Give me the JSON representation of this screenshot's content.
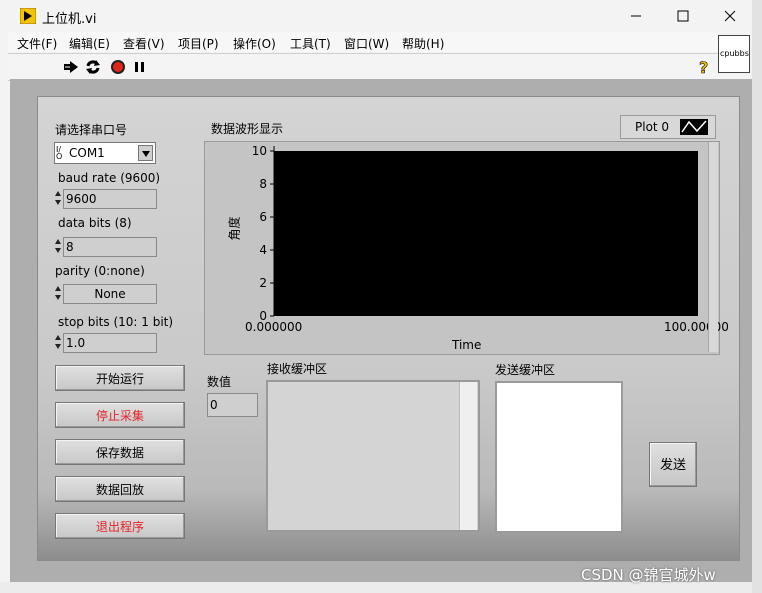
{
  "window": {
    "title": "上位机.vi",
    "right_box_label": "cpubbs"
  },
  "menu": [
    "文件(F)",
    "编辑(E)",
    "查看(V)",
    "项目(P)",
    "操作(O)",
    "工具(T)",
    "窗口(W)",
    "帮助(H)"
  ],
  "serial": {
    "port_label": "请选择串口号",
    "port_prefix": "I/O",
    "port_value": "COM1",
    "baud_label": "baud rate (9600)",
    "baud_value": "9600",
    "databits_label": "data bits (8)",
    "databits_value": "8",
    "parity_label": "parity (0:none)",
    "parity_value": "None",
    "stopbits_label": "stop bits (10: 1 bit)",
    "stopbits_value": "1.0"
  },
  "buttons": {
    "start": "开始运行",
    "stop": "停止采集",
    "save": "保存数据",
    "replay": "数据回放",
    "exit": "退出程序",
    "send": "发送"
  },
  "chart": {
    "title": "数据波形显示",
    "legend_name": "Plot 0",
    "y_label": "角度",
    "x_label": "Time",
    "x_min_label": "0.000000",
    "x_max_label": "100.00000",
    "y_ticks": [
      "10",
      "8",
      "6",
      "4",
      "2",
      "0"
    ]
  },
  "numeric": {
    "label": "数值",
    "value": "0"
  },
  "buffers": {
    "receive_label": "接收缓冲区",
    "send_label": "发送缓冲区"
  },
  "watermark": "CSDN @锦官城外w",
  "colors": {
    "stop_text": "#e2242a",
    "plot_bg": "#000000",
    "panel_bg": "#aeaeae"
  }
}
